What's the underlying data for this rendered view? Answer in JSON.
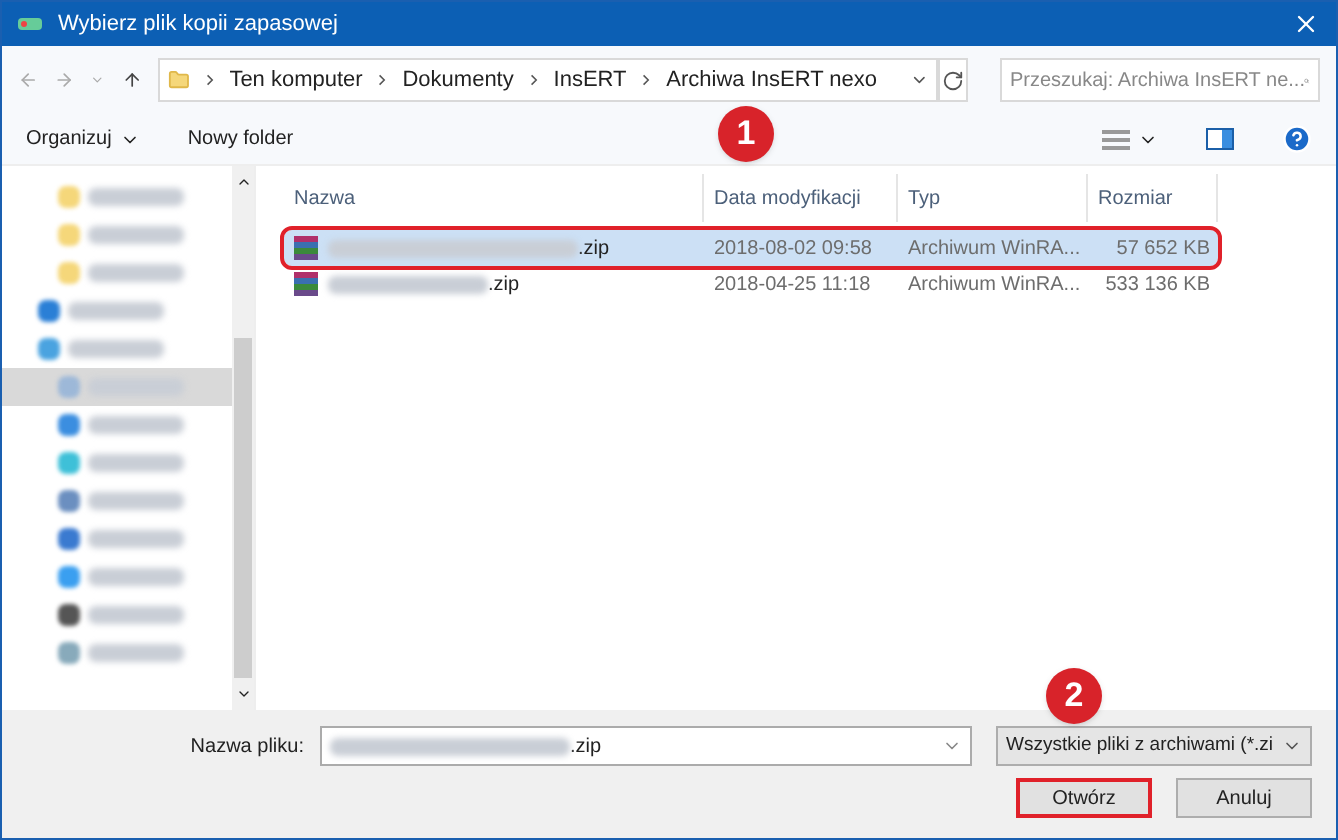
{
  "window": {
    "title": "Wybierz plik kopii zapasowej"
  },
  "address": {
    "crumbs": [
      "Ten komputer",
      "Dokumenty",
      "InsERT",
      "Archiwa InsERT nexo"
    ]
  },
  "search": {
    "placeholder": "Przeszukaj: Archiwa InsERT ne..."
  },
  "toolbar": {
    "organize": "Organizuj",
    "new_folder": "Nowy folder"
  },
  "sidebar": {
    "items": [
      {
        "kind": "folder",
        "indent": true,
        "selected": false
      },
      {
        "kind": "folder",
        "indent": true,
        "selected": false
      },
      {
        "kind": "folder",
        "indent": true,
        "selected": false
      },
      {
        "kind": "cloud",
        "indent": false,
        "selected": false
      },
      {
        "kind": "computer",
        "indent": false,
        "selected": false
      },
      {
        "kind": "documents",
        "indent": true,
        "selected": true
      },
      {
        "kind": "music",
        "indent": true,
        "selected": false
      },
      {
        "kind": "objects",
        "indent": true,
        "selected": false
      },
      {
        "kind": "images",
        "indent": true,
        "selected": false
      },
      {
        "kind": "downloads",
        "indent": true,
        "selected": false
      },
      {
        "kind": "desktop",
        "indent": true,
        "selected": false
      },
      {
        "kind": "video",
        "indent": true,
        "selected": false
      },
      {
        "kind": "disk",
        "indent": true,
        "selected": false
      }
    ]
  },
  "table": {
    "columns": [
      "Nazwa",
      "Data modyfikacji",
      "Typ",
      "Rozmiar"
    ],
    "rows": [
      {
        "name": ".zip",
        "date": "2018-08-02 09:58",
        "type": "Archiwum WinRA...",
        "size": "57 652 KB",
        "selected": true,
        "highlighted": true
      },
      {
        "name": ".zip",
        "date": "2018-04-25 11:18",
        "type": "Archiwum WinRA...",
        "size": "533 136 KB",
        "selected": false,
        "highlighted": false
      }
    ]
  },
  "filename": {
    "label": "Nazwa pliku:",
    "value": ".zip"
  },
  "filter": {
    "value": "Wszystkie pliki z archiwami (*.zi"
  },
  "buttons": [
    {
      "label": "Otwórz",
      "highlighted": true
    },
    {
      "label": "Anuluj",
      "highlighted": false
    }
  ],
  "badges": [
    "1",
    "2"
  ]
}
